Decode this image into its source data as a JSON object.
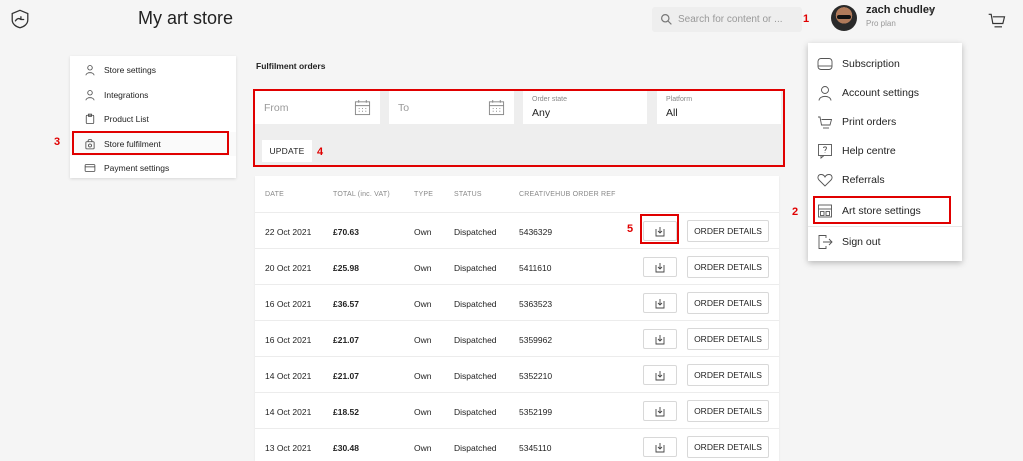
{
  "header": {
    "title": "My art store",
    "search_placeholder": "Search for content or ...",
    "user_name": "zach chudley",
    "user_caret": "▾",
    "user_plan": "Pro plan"
  },
  "annotations": {
    "a1": "1",
    "a2": "2",
    "a3": "3",
    "a4": "4",
    "a5": "5"
  },
  "sidebar": {
    "items": [
      {
        "label": "Store settings",
        "icon": "user-icon"
      },
      {
        "label": "Integrations",
        "icon": "user-icon"
      },
      {
        "label": "Product List",
        "icon": "clipboard-icon"
      },
      {
        "label": "Store fulfilment",
        "icon": "store-bag-icon"
      },
      {
        "label": "Payment settings",
        "icon": "card-icon"
      }
    ]
  },
  "main": {
    "section_title": "Fulfilment orders",
    "filters": {
      "from_placeholder": "From",
      "to_placeholder": "To",
      "order_state_label": "Order state",
      "order_state_value": "Any",
      "platform_label": "Platform",
      "platform_value": "All",
      "update_label": "UPDATE"
    },
    "table": {
      "columns": [
        "DATE",
        "TOTAL (inc. VAT)",
        "TYPE",
        "STATUS",
        "CREATIVEHUB ORDER REF"
      ],
      "order_details_label": "ORDER DETAILS",
      "rows": [
        {
          "date": "22 Oct 2021",
          "total": "£70.63",
          "type": "Own",
          "status": "Dispatched",
          "ref": "5436329"
        },
        {
          "date": "20 Oct 2021",
          "total": "£25.98",
          "type": "Own",
          "status": "Dispatched",
          "ref": "5411610"
        },
        {
          "date": "16 Oct 2021",
          "total": "£36.57",
          "type": "Own",
          "status": "Dispatched",
          "ref": "5363523"
        },
        {
          "date": "16 Oct 2021",
          "total": "£21.07",
          "type": "Own",
          "status": "Dispatched",
          "ref": "5359962"
        },
        {
          "date": "14 Oct 2021",
          "total": "£21.07",
          "type": "Own",
          "status": "Dispatched",
          "ref": "5352210"
        },
        {
          "date": "14 Oct 2021",
          "total": "£18.52",
          "type": "Own",
          "status": "Dispatched",
          "ref": "5352199"
        },
        {
          "date": "13 Oct 2021",
          "total": "£30.48",
          "type": "Own",
          "status": "Dispatched",
          "ref": "5345110"
        }
      ]
    }
  },
  "dropdown": {
    "items": [
      {
        "label": "Subscription",
        "icon": "subscription-icon"
      },
      {
        "label": "Account settings",
        "icon": "user-icon"
      },
      {
        "label": "Print orders",
        "icon": "cart-icon"
      },
      {
        "label": "Help centre",
        "icon": "help-icon"
      },
      {
        "label": "Referrals",
        "icon": "heart-icon"
      },
      {
        "label": "Art store settings",
        "icon": "store-icon"
      },
      {
        "label": "Sign out",
        "icon": "sign-out-icon"
      }
    ]
  },
  "colors": {
    "annotation_red": "#e00000",
    "background": "#f5f5f5",
    "panel": "#eeeeee"
  }
}
